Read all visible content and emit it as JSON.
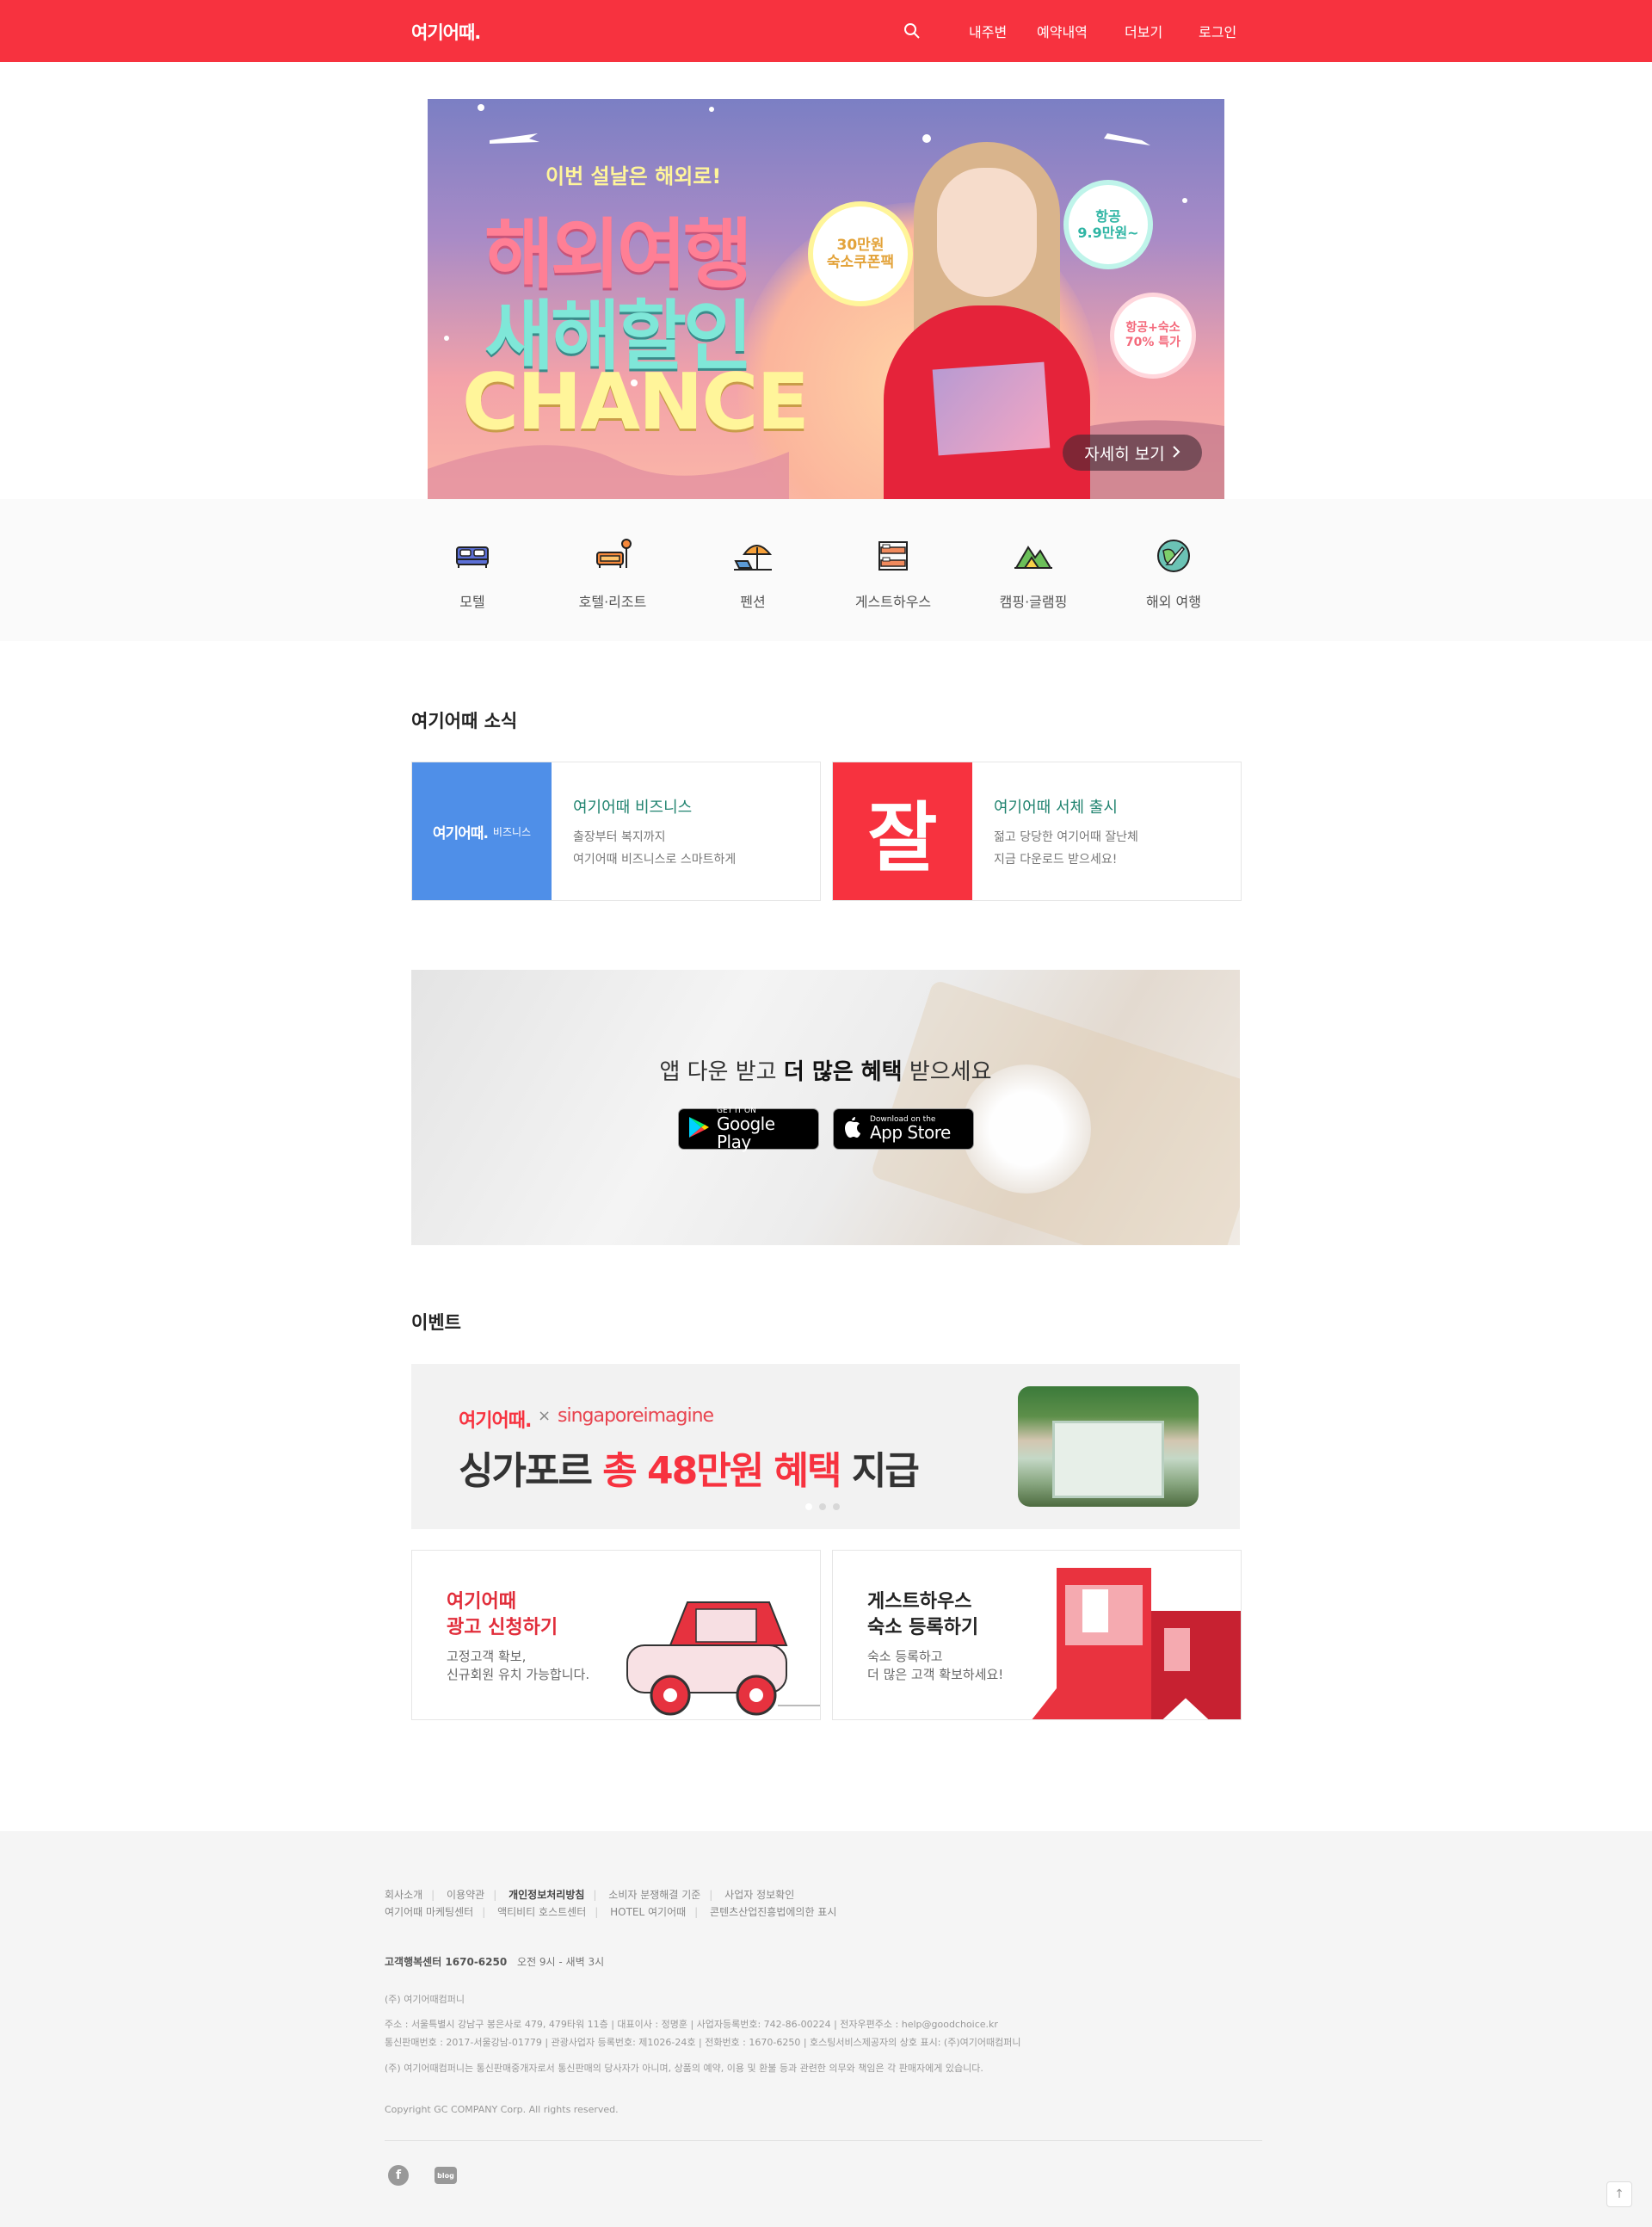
{
  "header": {
    "logo": "여기어때.",
    "search_icon": "search-icon",
    "nav": [
      "내주변",
      "예약내역",
      "더보기",
      "로그인"
    ]
  },
  "banner": {
    "subtitle": "이번 설날은 해외로!",
    "line1": "해외여행",
    "line2": "새해할인",
    "line3": "CHANCE",
    "badge1": "30만원\n숙소쿠폰팩",
    "badge2": "항공\n9.9만원~",
    "badge3": "항공+숙소\n70% 특가",
    "more_label": "자세히 보기",
    "more_icon": "chevron-right-icon"
  },
  "categories": [
    {
      "label": "모텔",
      "icon": "bed-icon"
    },
    {
      "label": "호텔·리조트",
      "icon": "sofa-icon"
    },
    {
      "label": "펜션",
      "icon": "beach-umbrella-icon"
    },
    {
      "label": "게스트하우스",
      "icon": "bunk-bed-icon"
    },
    {
      "label": "캠핑·글램핑",
      "icon": "tent-icon"
    },
    {
      "label": "해외 여행",
      "icon": "globe-plane-icon"
    }
  ],
  "news": {
    "title": "여기어때 소식",
    "cards": [
      {
        "thumb_text": "여기어때.",
        "thumb_sub": "비즈니스",
        "title": "여기어때 비즈니스",
        "desc1": "출장부터 복지까지",
        "desc2": "여기어때 비즈니스로 스마트하게"
      },
      {
        "thumb_text": "잘",
        "title": "여기어때 서체 출시",
        "desc1": "젊고 당당한 여기어때 잘난체",
        "desc2": "지금 다운로드 받으세요!"
      }
    ]
  },
  "app": {
    "text_pre": "앱 다운 받고 ",
    "text_bold": "더 많은 혜택",
    "text_post": " 받으세요",
    "google_small": "GET IT ON",
    "google_big": "Google Play",
    "apple_small": "Download on the",
    "apple_big": "App Store"
  },
  "events": {
    "title": "이벤트",
    "banner_brand": "여기어때.",
    "banner_x": "×",
    "banner_partner": "singaporeimagine",
    "headline_pre": "싱가포르 ",
    "headline_red": "총 48만원 혜택",
    "headline_post": " 지급",
    "promo": [
      {
        "title1": "여기어때",
        "title2": "광고 신청하기",
        "desc1": "고정고객 확보,",
        "desc2": "신규회원 유치 가능합니다."
      },
      {
        "title1": "게스트하우스",
        "title2": "숙소 등록하기",
        "desc1": "숙소 등록하고",
        "desc2": "더 많은 고객 확보하세요!"
      }
    ]
  },
  "footer": {
    "links1": [
      "회사소개",
      "이용약관",
      "개인정보처리방침",
      "소비자 분쟁해결 기준",
      "사업자 정보확인"
    ],
    "links2": [
      "여기어때 마케팅센터",
      "액티비티 호스트센터",
      "HOTEL 여기어때",
      "콘텐츠산업진흥법에의한 표시"
    ],
    "cs_label": "고객행복센터 1670-6250",
    "cs_hours": "오전 9시 - 새벽 3시",
    "company": "(주) 여기어때컴퍼니",
    "addr1": "주소 : 서울특별시 강남구 봉은사로 479, 479타워 11층 | 대표이사 : 정명훈 | 사업자등록번호: 742-86-00224 | 전자우편주소 : help@goodchoice.kr",
    "addr2": "통신판매번호 : 2017-서울강남-01779 | 관광사업자 등록번호: 제1026-24호 | 전화번호 : 1670-6250 | 호스팅서비스제공자의 상호 표시: (주)여기어때컴퍼니",
    "notice": "(주) 여기어때컴퍼니는 통신판매중개자로서 통신판매의 당사자가 아니며, 상품의 예약, 이용 및 환불 등과 관련한 의무와 책임은 각 판매자에게 있습니다.",
    "copyright": "Copyright GC COMPANY Corp. All rights reserved.",
    "facebook_icon": "facebook-icon",
    "blog_icon": "blog-icon",
    "blog_label": "blog",
    "top_icon": "arrow-up-icon"
  }
}
